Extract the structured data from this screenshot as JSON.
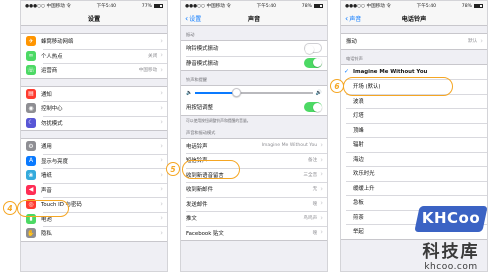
{
  "status": {
    "carrier": "●●●○○ 中国移动 令",
    "time": "下午5:40",
    "battery_pct": 0.77
  },
  "screen1": {
    "title": "设置",
    "battery_text": "77%",
    "group1": [
      {
        "icon": "airplane-icon",
        "color": "#ff9500",
        "label": "蜂窝移动网络",
        "value": ""
      },
      {
        "icon": "hotspot-icon",
        "color": "#4cd964",
        "label": "个人热点",
        "value": "关闭"
      },
      {
        "icon": "carrier-icon",
        "color": "#4cd964",
        "label": "运营商",
        "value": "中国移动"
      }
    ],
    "group2": [
      {
        "icon": "notification-icon",
        "color": "#ff3b30",
        "label": "通知",
        "value": ""
      },
      {
        "icon": "control-center-icon",
        "color": "#8e8e93",
        "label": "控制中心",
        "value": ""
      },
      {
        "icon": "moon-icon",
        "color": "#5856d6",
        "label": "勿扰模式",
        "value": ""
      }
    ],
    "group3": [
      {
        "icon": "gear-icon",
        "color": "#8e8e93",
        "label": "通用",
        "value": ""
      },
      {
        "icon": "display-icon",
        "color": "#0a7aff",
        "label": "显示与亮度",
        "value": ""
      },
      {
        "icon": "wallpaper-icon",
        "color": "#34aadc",
        "label": "墙纸",
        "value": ""
      },
      {
        "icon": "sound-icon",
        "color": "#ff2d55",
        "label": "声音",
        "value": ""
      },
      {
        "icon": "touchid-icon",
        "color": "#ff3b30",
        "label": "Touch ID 与密码",
        "value": ""
      },
      {
        "icon": "battery-icon",
        "color": "#4cd964",
        "label": "电池",
        "value": ""
      },
      {
        "icon": "hand-icon",
        "color": "#8e8e93",
        "label": "隐私",
        "value": ""
      }
    ]
  },
  "screen2": {
    "back": "设置",
    "title": "声音",
    "battery_text": "78%",
    "vibrate_header": "振动",
    "vibrate_rows": [
      {
        "label": "响铃模式振动",
        "on": false
      },
      {
        "label": "静音模式振动",
        "on": true
      }
    ],
    "ringer_header": "铃声和提醒",
    "volume_level": 0.35,
    "buttons_row": {
      "label": "用按钮调整",
      "on": true
    },
    "buttons_note": "可以使用按钮调整铃声和提醒的音量。",
    "patterns_header": "声音和振动模式",
    "patterns": [
      {
        "label": "电话铃声",
        "value": "Imagine Me Without You"
      },
      {
        "label": "短信铃声",
        "value": "备注"
      },
      {
        "label": "收到新语音留言",
        "value": "三全音"
      },
      {
        "label": "收到新邮件",
        "value": "无"
      },
      {
        "label": "发送邮件",
        "value": "嗖"
      },
      {
        "label": "推文",
        "value": "鸟鸣声"
      },
      {
        "label": "Facebook 贴文",
        "value": "嗖"
      }
    ]
  },
  "screen3": {
    "back": "声音",
    "title": "电话铃声",
    "battery_text": "78%",
    "vibrate_label": "振动",
    "vibrate_value": "默认",
    "ringtones_header": "电话铃声",
    "ringtones": [
      "Imagine Me Without You",
      "开场 (默认)",
      "波浪",
      "灯塔",
      "顶峰",
      "辐射",
      "海边",
      "欢乐时光",
      "缓缓上升",
      "急板",
      "煎茶",
      "举起"
    ],
    "selected_index": 0
  },
  "steps": {
    "s4": "4",
    "s5": "5",
    "s6": "6"
  },
  "watermark": {
    "logo": "KHCoo",
    "cn": "科技库",
    "domain": "khcoo.com"
  }
}
